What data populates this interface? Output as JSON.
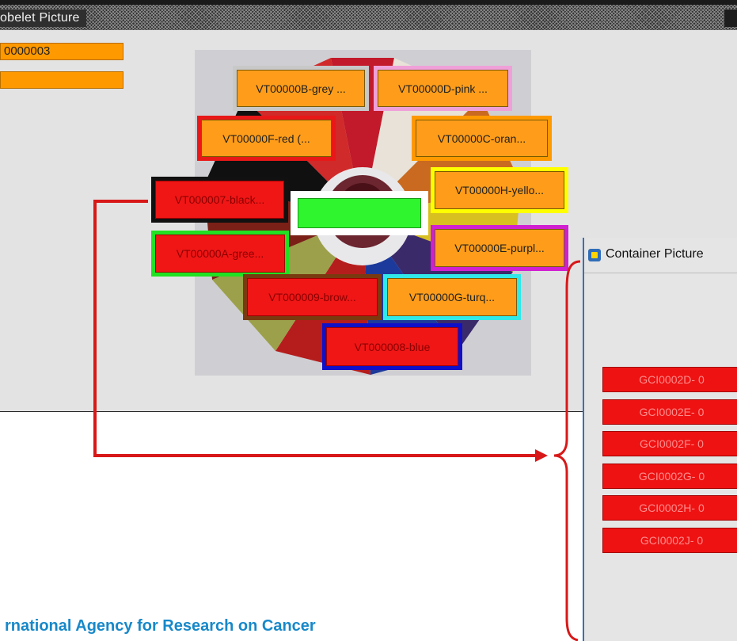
{
  "tubelet_window": {
    "title": "obelet Picture",
    "fields": [
      "0000003",
      ""
    ],
    "center_tag": ""
  },
  "tags": [
    {
      "id": "tag-grey",
      "label": "VT00000B-grey ...",
      "frame": "#c8c8c8",
      "fill": "orange"
    },
    {
      "id": "tag-pink",
      "label": "VT00000D-pink ...",
      "frame": "#f0a0d8",
      "fill": "orange"
    },
    {
      "id": "tag-red",
      "label": "VT00000F-red (...",
      "frame": "#e81818",
      "fill": "orange"
    },
    {
      "id": "tag-orange",
      "label": "VT00000C-oran...",
      "frame": "#ff9900",
      "fill": "orange"
    },
    {
      "id": "tag-black",
      "label": "VT000007-black...",
      "frame": "#111111",
      "fill": "red"
    },
    {
      "id": "tag-yellow",
      "label": "VT00000H-yello...",
      "frame": "#ffff00",
      "fill": "orange"
    },
    {
      "id": "tag-green",
      "label": "VT00000A-gree...",
      "frame": "#22e022",
      "fill": "red"
    },
    {
      "id": "tag-purple",
      "label": "VT00000E-purpl...",
      "frame": "#d020d0",
      "fill": "orange"
    },
    {
      "id": "tag-brown",
      "label": "VT000009-brow...",
      "frame": "#7a3a10",
      "fill": "red"
    },
    {
      "id": "tag-turquoise",
      "label": "VT00000G-turq...",
      "frame": "#30e8e8",
      "fill": "orange"
    },
    {
      "id": "tag-blue",
      "label": "VT000008-blue",
      "frame": "#1010c8",
      "fill": "red"
    }
  ],
  "container_window": {
    "title": "Container Picture",
    "items": [
      "GCI0002D- 0",
      "GCI0002E- 0",
      "GCI0002F- 0",
      "GCI0002G- 0",
      "GCI0002H- 0",
      "GCI0002J- 0"
    ]
  },
  "footer": {
    "text": "rnational Agency for Research on Cancer"
  },
  "colors": {
    "accent_text": "#1788c9",
    "arrow": "#d81818",
    "tag_orange": "#ff9d1a",
    "tag_red": "#f01616"
  },
  "icons": [
    "container-window-icon"
  ]
}
